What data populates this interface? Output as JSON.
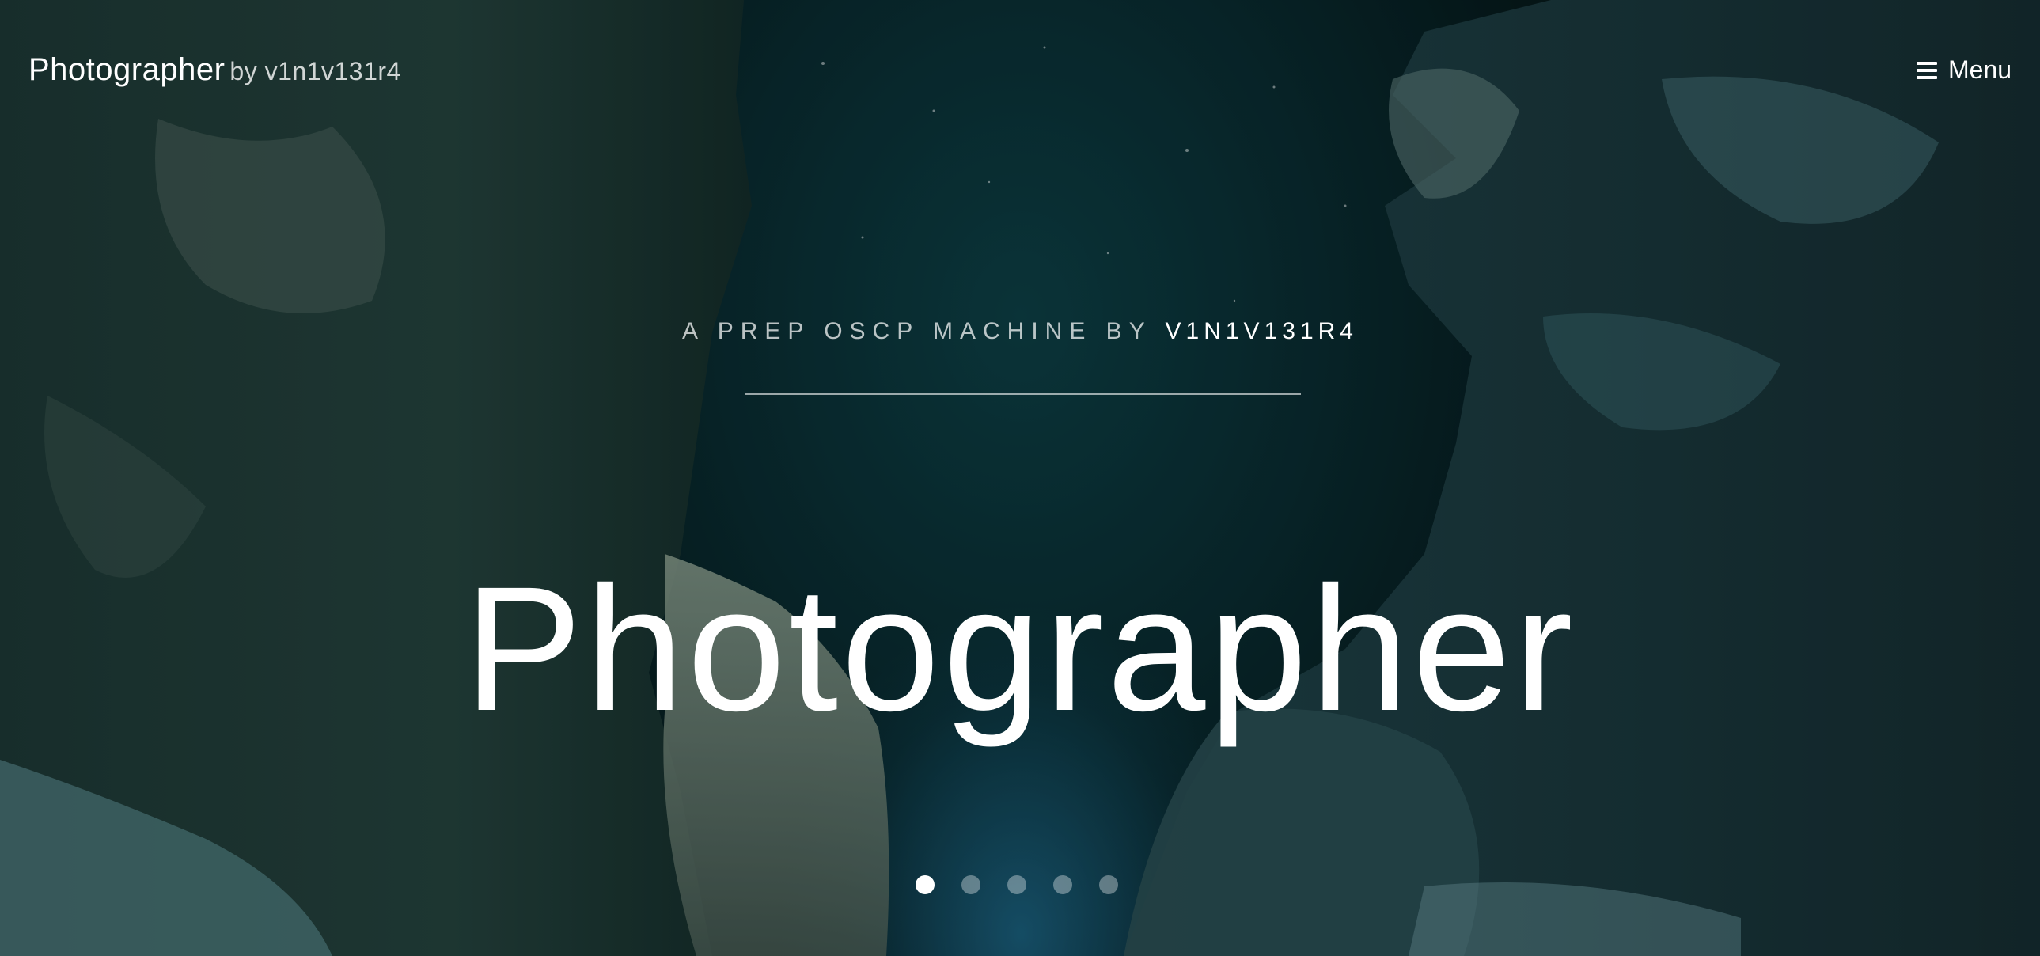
{
  "header": {
    "brand_title": "Photographer",
    "brand_by": "by v1n1v131r4",
    "menu_label": "Menu",
    "menu_icon": "hamburger-icon"
  },
  "hero": {
    "tagline_prefix": "A PREP OSCP MACHINE BY",
    "tagline_author": "V1N1V131R4",
    "title": "Photographer",
    "background": "night-canyon-rocks-photo"
  },
  "slider": {
    "slide_count": 5,
    "active_index": 0
  },
  "colors": {
    "sky": "#0b3a40",
    "glow": "#2a8cbe",
    "text": "#ffffff"
  }
}
